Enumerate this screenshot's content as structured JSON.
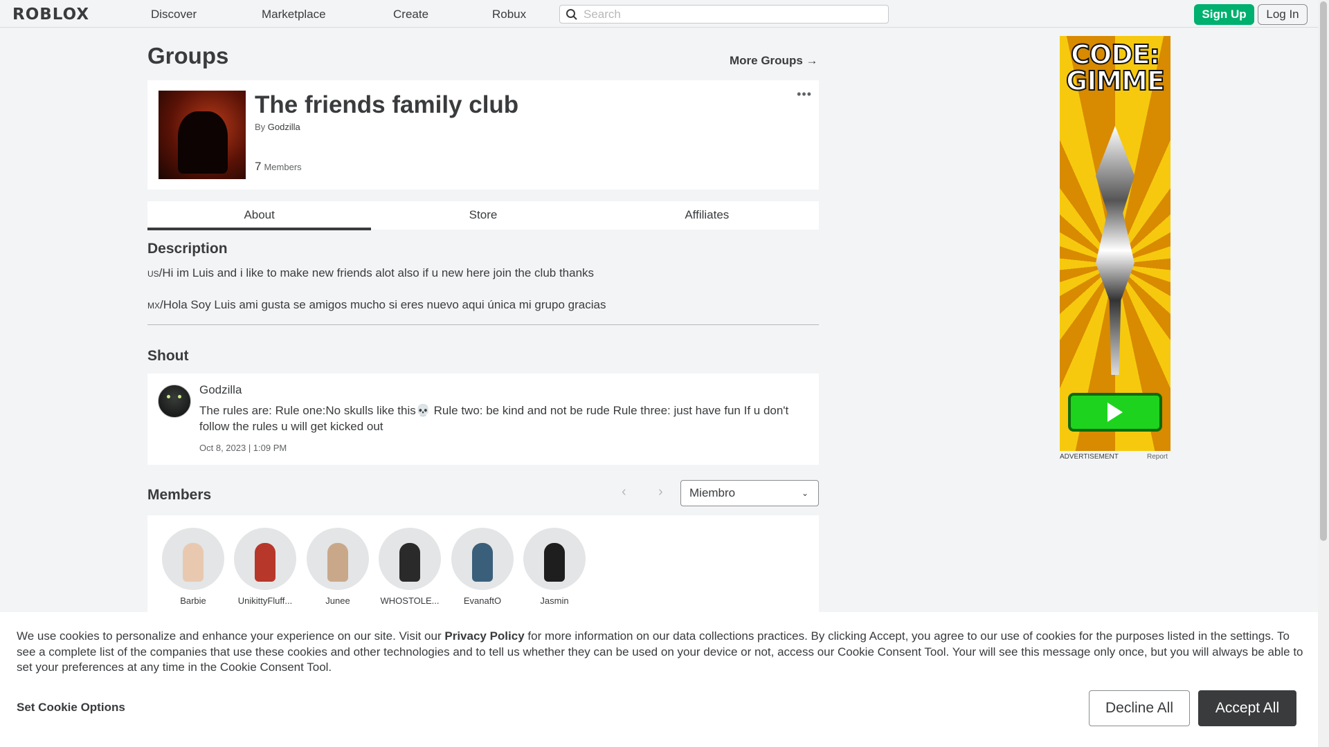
{
  "nav": {
    "logo": "ROBLOX",
    "items": [
      "Discover",
      "Marketplace",
      "Create",
      "Robux"
    ],
    "search_placeholder": "Search",
    "signup": "Sign Up",
    "login": "Log In"
  },
  "page": {
    "title": "Groups",
    "more_groups": "More Groups →"
  },
  "group": {
    "name": "The friends family club",
    "by_label": "By",
    "owner": "Godzilla",
    "member_count": "7",
    "member_label": "Members",
    "menu": "•••"
  },
  "tabs": [
    "About",
    "Store",
    "Affiliates"
  ],
  "description": {
    "heading": "Description",
    "lines": [
      {
        "flag": "US",
        "text": "/Hi im Luis and i like to make new friends alot also if u new here join the club thanks"
      },
      {
        "flag": "MX",
        "text": "/Hola Soy Luis ami gusta se amigos mucho si eres nuevo aqui única mi grupo gracias"
      }
    ]
  },
  "shout": {
    "heading": "Shout",
    "author": "Godzilla",
    "body": "The rules are: Rule one:No skulls like this💀 Rule two: be kind and not be rude Rule three: just have fun If u don't follow the rules u will get kicked out",
    "date": "Oct 8, 2023 | 1:09 PM"
  },
  "members": {
    "heading": "Members",
    "role_selected": "Miembro",
    "list": [
      {
        "name": "Barbie",
        "color": "#e8c9b0"
      },
      {
        "name": "UnikittyFluff...",
        "color": "#b7372a"
      },
      {
        "name": "Junee",
        "color": "#c9a88a"
      },
      {
        "name": "WHOSTOLE...",
        "color": "#2a2a2a"
      },
      {
        "name": "EvanaftO",
        "color": "#3a5f7a"
      },
      {
        "name": "Jasmin",
        "color": "#1e1e1e"
      }
    ]
  },
  "ad": {
    "title": "CODE: GIMME",
    "label": "ADVERTISEMENT",
    "report": "Report"
  },
  "cookie": {
    "text_before": "We use cookies to personalize and enhance your experience on our site. Visit our ",
    "link": "Privacy Policy",
    "text_after": " for more information on our data collections practices. By clicking Accept, you agree to our use of cookies for the purposes listed in the settings. To see a complete list of the companies that use these cookies and other technologies and to tell us whether they can be used on your device or not, access our Cookie Consent Tool. Your will see this message only once, but you will always be able to set your preferences at any time in the Cookie Consent Tool.",
    "options": "Set Cookie Options",
    "decline": "Decline All",
    "accept": "Accept All"
  }
}
